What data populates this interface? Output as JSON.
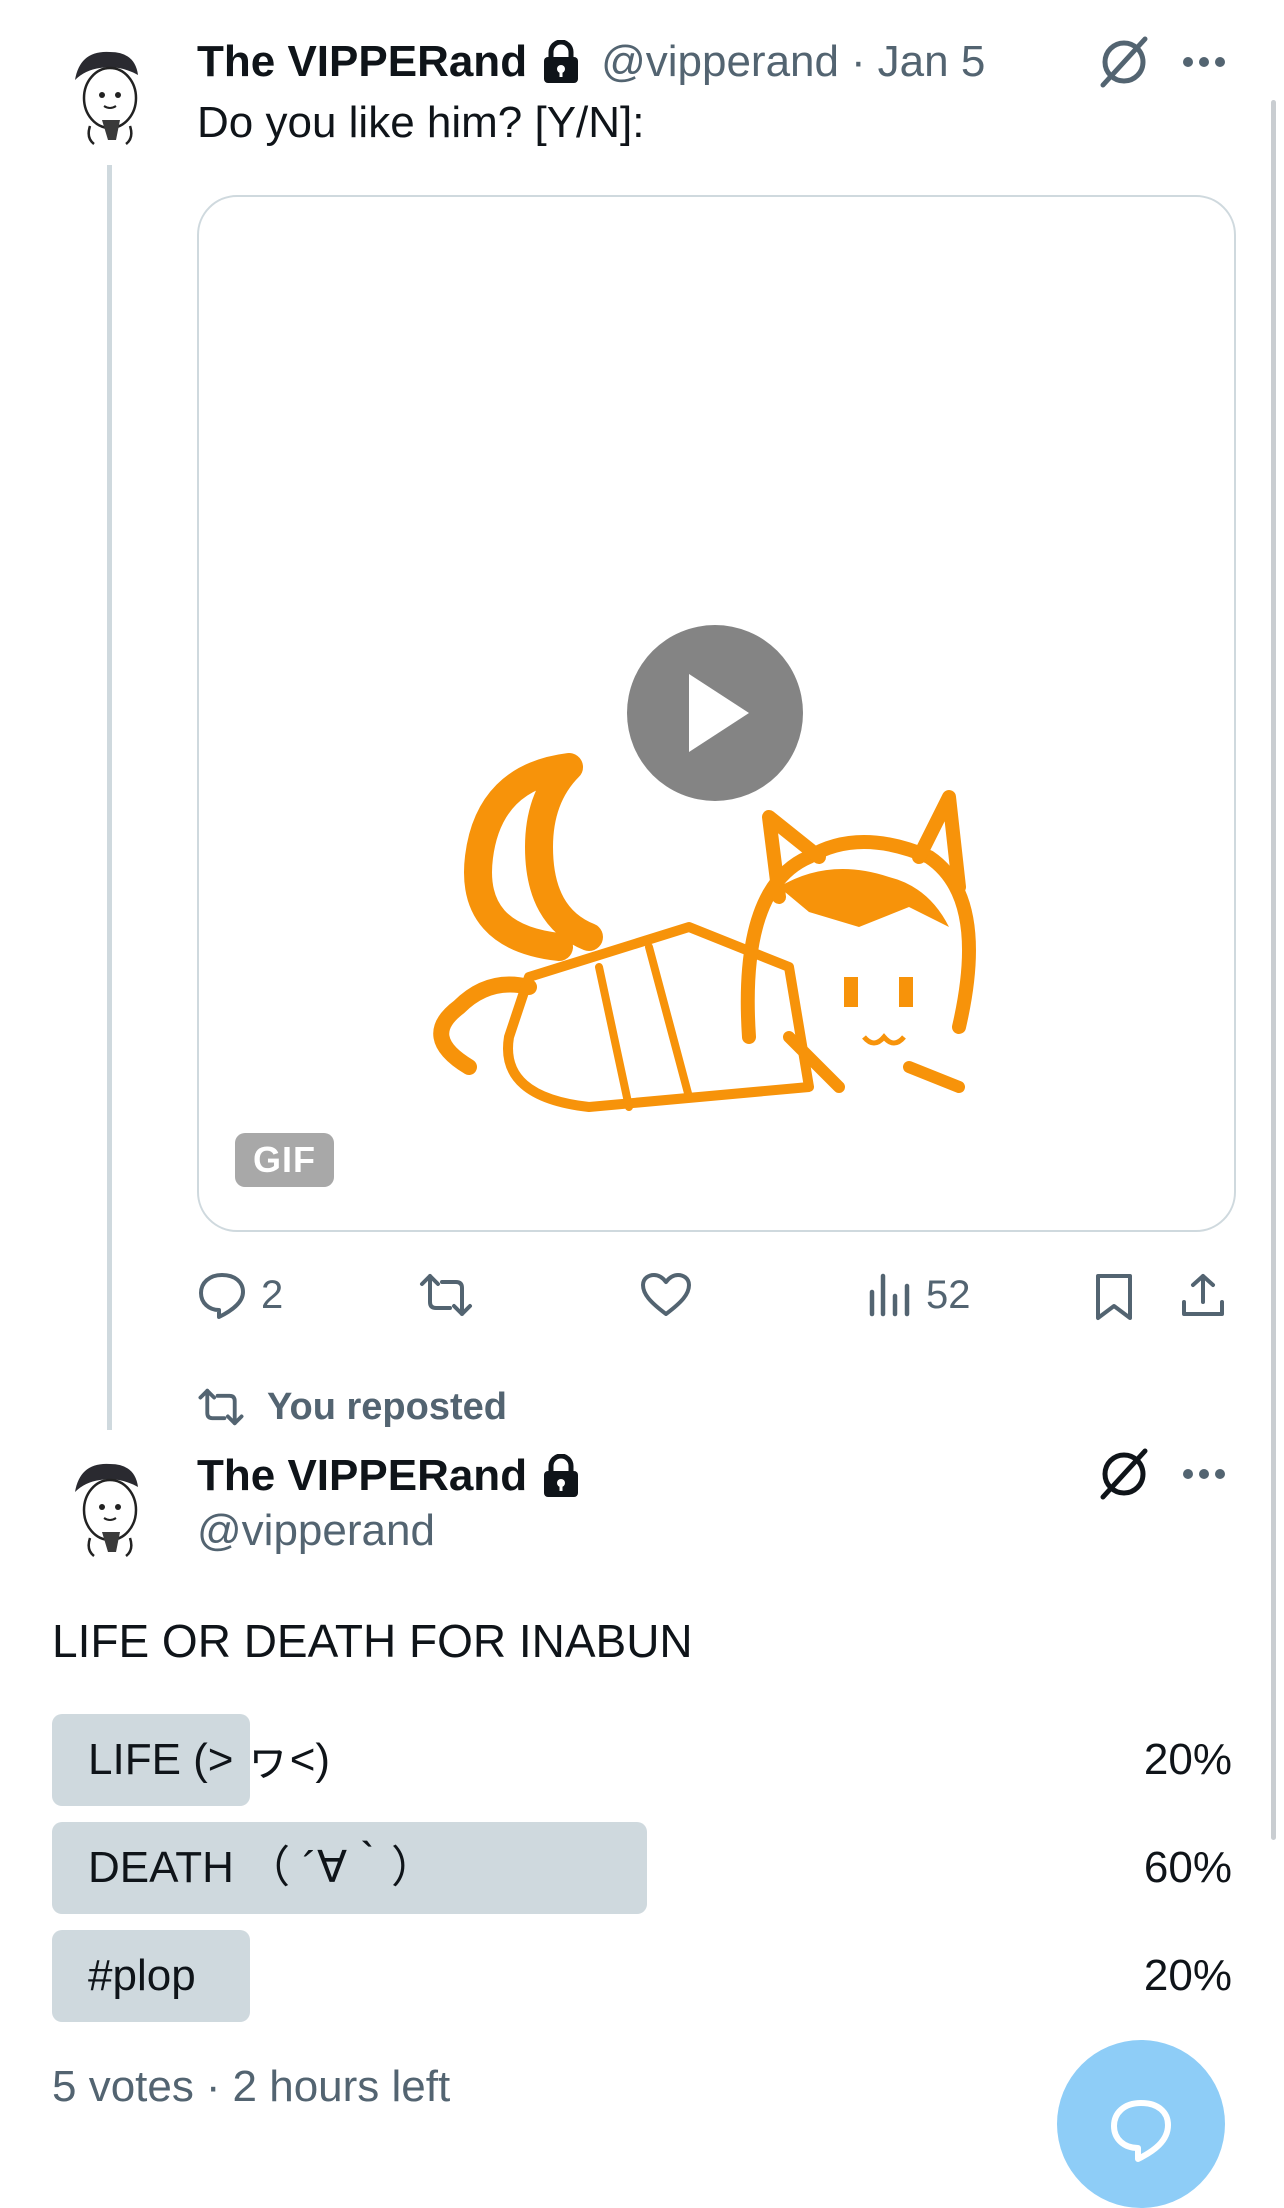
{
  "tweet1": {
    "name": "The VIPPERand",
    "handle": "@vipperand",
    "sep": "·",
    "date": "Jan 5",
    "text": "Do you like him? [Y/N]:",
    "gif_label": "GIF",
    "actions": {
      "replies": "2",
      "retweets": "",
      "likes": "",
      "views": "52"
    }
  },
  "repost_notice": "You reposted",
  "tweet2": {
    "name": "The VIPPERand",
    "handle": "@vipperand",
    "text": "LIFE OR DEATH FOR INABUN",
    "poll": {
      "options": [
        {
          "label": "LIFE (˃ ヮ˂)",
          "pct": "20%",
          "fraction": 0.2
        },
        {
          "label": "DEATH （ ´∀｀）",
          "pct": "60%",
          "fraction": 0.6
        },
        {
          "label": "#plop",
          "pct": "20%",
          "fraction": 0.2
        }
      ],
      "votes": "5 votes",
      "sep": "·",
      "time_left": "2 hours left"
    }
  },
  "colors": {
    "accent": "#1d9bf0",
    "fab": "#8ecdf7",
    "gif_orange": "#f7930a",
    "poll_bar": "#cfd9de",
    "muted": "#536471"
  },
  "icons": [
    "lock-icon",
    "grok-icon",
    "more-icon",
    "play-icon",
    "reply-icon",
    "retweet-icon",
    "like-icon",
    "views-icon",
    "bookmark-icon",
    "share-icon",
    "compose-icon"
  ]
}
